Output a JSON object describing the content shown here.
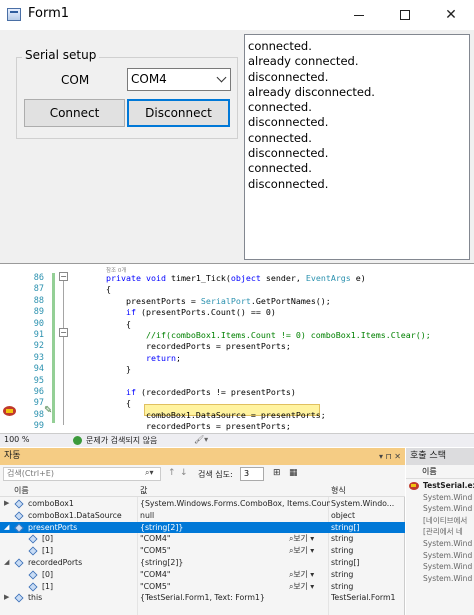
{
  "window": {
    "title": "Form1",
    "min_glyph": "",
    "close_glyph": "✕"
  },
  "form": {
    "group_label": "Serial setup",
    "com_label": "COM",
    "com_value": "COM4",
    "connect_label": "Connect",
    "disconnect_label": "Disconnect",
    "log_lines": [
      "connected.",
      "already connected.",
      "disconnected.",
      "already disconnected.",
      "connected.",
      "disconnected.",
      "connected.",
      "disconnected.",
      "connected.",
      "disconnected."
    ]
  },
  "editor": {
    "codelens_hint": "참조 0개",
    "lines": [
      {
        "n": "86",
        "html": "<span class=\"kw\">private</span> <span class=\"kw\">void</span> timer1_Tick(<span class=\"kw\">object</span> sender, <span class=\"ty\">EventArgs</span> e)"
      },
      {
        "n": "87",
        "html": "{"
      },
      {
        "n": "88",
        "html": "    presentPorts = <span class=\"ty\">SerialPort</span>.GetPortNames();"
      },
      {
        "n": "89",
        "html": "    <span class=\"kw\">if</span> (presentPorts.Count() == 0)"
      },
      {
        "n": "90",
        "html": "    {"
      },
      {
        "n": "91",
        "html": "        <span class=\"cm\">//if(comboBox1.Items.Count != 0) comboBox1.Items.Clear();</span>"
      },
      {
        "n": "92",
        "html": "        recordedPorts = presentPorts;"
      },
      {
        "n": "93",
        "html": "        <span class=\"kw\">return</span>;"
      },
      {
        "n": "94",
        "html": "    }"
      },
      {
        "n": "95",
        "html": ""
      },
      {
        "n": "96",
        "html": "    <span class=\"kw\">if</span> (recordedPorts != presentPorts)"
      },
      {
        "n": "97",
        "html": "    {"
      },
      {
        "n": "98",
        "html": "        comboBox1.DataSource = presentPorts;"
      },
      {
        "n": "99",
        "html": "        recordedPorts = presentPorts;"
      }
    ]
  },
  "status": {
    "zoom": "100 %",
    "message": "문제가 검색되지 않음"
  },
  "autos": {
    "title": "자동",
    "search_placeholder": "검색(Ctrl+E)",
    "depth_label": "검색 심도:",
    "depth_value": "3",
    "col_name": "이름",
    "col_value": "값",
    "col_type": "형식",
    "rows": [
      {
        "name": "comboBox1",
        "value": "{System.Windows.Forms.ComboBox, Items.Coun...",
        "view": "",
        "type": "System.Windo...",
        "indent": 0,
        "exp": "▶",
        "sel": false
      },
      {
        "name": "comboBox1.DataSource",
        "value": "null",
        "view": "",
        "type": "object",
        "indent": 0,
        "exp": "",
        "sel": false
      },
      {
        "name": "presentPorts",
        "value": "{string[2]}",
        "view": "",
        "type": "string[]",
        "indent": 0,
        "exp": "◢",
        "sel": true
      },
      {
        "name": "[0]",
        "value": "\"COM4\"",
        "view": "보기 ▾",
        "type": "string",
        "indent": 1,
        "exp": "",
        "sel": false
      },
      {
        "name": "[1]",
        "value": "\"COM5\"",
        "view": "보기 ▾",
        "type": "string",
        "indent": 1,
        "exp": "",
        "sel": false
      },
      {
        "name": "recordedPorts",
        "value": "{string[2]}",
        "view": "",
        "type": "string[]",
        "indent": 0,
        "exp": "◢",
        "sel": false
      },
      {
        "name": "[0]",
        "value": "\"COM4\"",
        "view": "보기 ▾",
        "type": "string",
        "indent": 1,
        "exp": "",
        "sel": false
      },
      {
        "name": "[1]",
        "value": "\"COM5\"",
        "view": "보기 ▾",
        "type": "string",
        "indent": 1,
        "exp": "",
        "sel": false
      },
      {
        "name": "this",
        "value": "{TestSerial.Form1, Text: Form1}",
        "view": "",
        "type": "TestSerial.Form1",
        "indent": 0,
        "exp": "▶",
        "sel": false
      }
    ]
  },
  "callstack": {
    "title": "호출 스택",
    "col_name": "이름",
    "rows": [
      {
        "text": "TestSerial.exe",
        "cur": true
      },
      {
        "text": "System.Wind",
        "cur": false
      },
      {
        "text": "System.Wind",
        "cur": false
      },
      {
        "text": "[네이티브에서",
        "cur": false
      },
      {
        "text": "[관리에서 네",
        "cur": false
      },
      {
        "text": "System.Wind",
        "cur": false
      },
      {
        "text": "System.Wind",
        "cur": false
      },
      {
        "text": "System.Wind",
        "cur": false
      },
      {
        "text": "System.Wind",
        "cur": false
      }
    ]
  }
}
